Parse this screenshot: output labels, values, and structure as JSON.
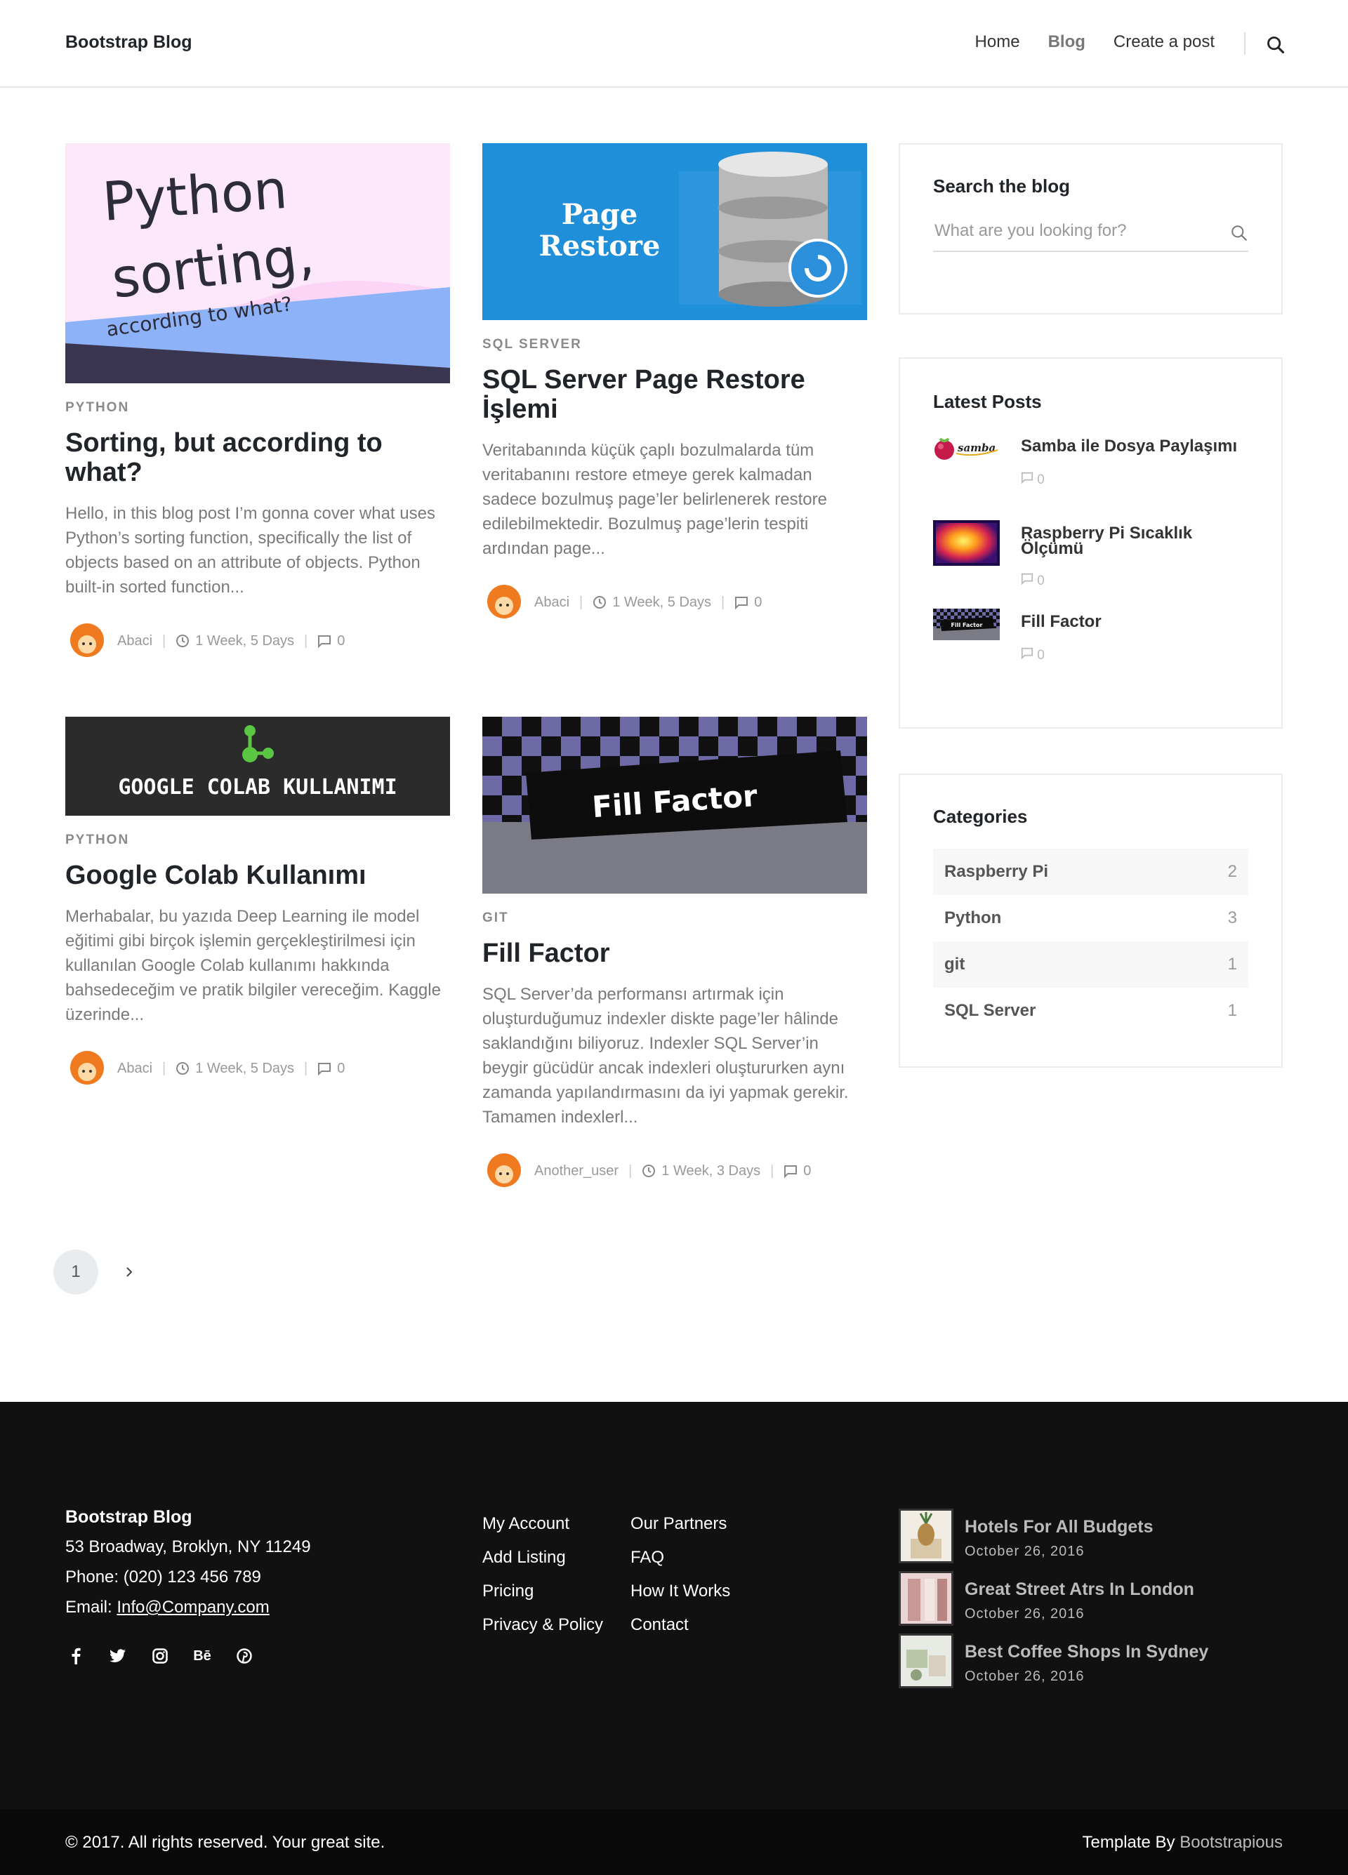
{
  "navbar": {
    "brand": "Bootstrap Blog",
    "links": [
      "Home",
      "Blog",
      "Create a post"
    ],
    "active": "Blog"
  },
  "posts": [
    {
      "image_text": [
        "Python",
        "sorting,",
        "according to what?"
      ],
      "category": "PYTHON",
      "title": "Sorting, but according to what?",
      "excerpt": "Hello, in this blog post I’m gonna cover what uses Python’s sorting function, specifically the list of objects based on an attribute of objects. Python built-in sorted function...",
      "author": "Abaci",
      "date": "1 Week, 5 Days",
      "comments": "0"
    },
    {
      "image_text": [
        "Page",
        "Restore"
      ],
      "category": "SQL SERVER",
      "title": "SQL Server Page Restore İşlemi",
      "excerpt": "Veritabanında küçük çaplı bozulmalarda tüm veritabanını restore etmeye gerek kalmadan sadece bozulmuş page’ler belirlenerek restore edilebilmektedir. Bozulmuş page’lerin tespiti ardından page...",
      "author": "Abaci",
      "date": "1 Week, 5 Days",
      "comments": "0"
    },
    {
      "image_text": [
        "GOOGLE COLAB KULLANIMI"
      ],
      "category": "PYTHON",
      "title": "Google Colab Kullanımı",
      "excerpt": "Merhabalar, bu yazıda Deep Learning ile model eğitimi gibi birçok işlemin gerçekleştirilmesi için kullanılan Google Colab kullanımı hakkında bahsedeceğim ve pratik bilgiler vereceğim. Kaggle üzerinde...",
      "author": "Abaci",
      "date": "1 Week, 5 Days",
      "comments": "0"
    },
    {
      "image_text": [
        "Fill Factor"
      ],
      "category": "GIT",
      "title": "Fill Factor",
      "excerpt": "SQL Server’da performansı artırmak için oluşturduğumuz indexler diskte page’ler hâlinde saklandığını biliyoruz. Indexler SQL Server’in beygir gücüdür ancak indexleri oluştururken aynı zamanda yapılandırmasını da iyi yapmak gerekir. Tamamen indexlerl...",
      "author": "Another_user",
      "date": "1 Week, 3 Days",
      "comments": "0"
    }
  ],
  "sidebar": {
    "search": {
      "title": "Search the blog",
      "placeholder": "What are you looking for?"
    },
    "latest": {
      "title": "Latest Posts",
      "thumb_text": "samba",
      "fill_thumb_text": "Fill Factor",
      "items": [
        {
          "title": "Samba ile Dosya Paylaşımı",
          "comments": "0"
        },
        {
          "title": "Raspberry Pi Sıcaklık Ölçümü",
          "comments": "0"
        },
        {
          "title": "Fill Factor",
          "comments": "0"
        }
      ]
    },
    "categories": {
      "title": "Categories",
      "items": [
        {
          "name": "Raspberry Pi",
          "count": "2"
        },
        {
          "name": "Python",
          "count": "3"
        },
        {
          "name": "git",
          "count": "1"
        },
        {
          "name": "SQL Server",
          "count": "1"
        }
      ]
    }
  },
  "pagination": {
    "current": "1"
  },
  "footer": {
    "brand": "Bootstrap Blog",
    "address": "53 Broadway, Broklyn, NY 11249",
    "phone": "Phone: (020) 123 456 789",
    "email_label": "Email: ",
    "email": "Info@Company.com",
    "socials": [
      "facebook-icon",
      "twitter-icon",
      "instagram-icon",
      "behance-icon",
      "pinterest-icon"
    ],
    "behance_text": "Bē",
    "links_col1": [
      "My Account",
      "Add Listing",
      "Pricing",
      "Privacy & Policy"
    ],
    "links_col2": [
      "Our Partners",
      "FAQ",
      "How It Works",
      "Contact"
    ],
    "posts": [
      {
        "title": "Hotels For All Budgets",
        "date": "October 26, 2016"
      },
      {
        "title": "Great Street Atrs In London",
        "date": "October 26, 2016"
      },
      {
        "title": "Best Coffee Shops In Sydney",
        "date": "October 26, 2016"
      }
    ]
  },
  "copyright": {
    "left": "© 2017. All rights reserved. Your great site.",
    "right_prefix": "Template By ",
    "right_link": "Bootstrapious"
  }
}
